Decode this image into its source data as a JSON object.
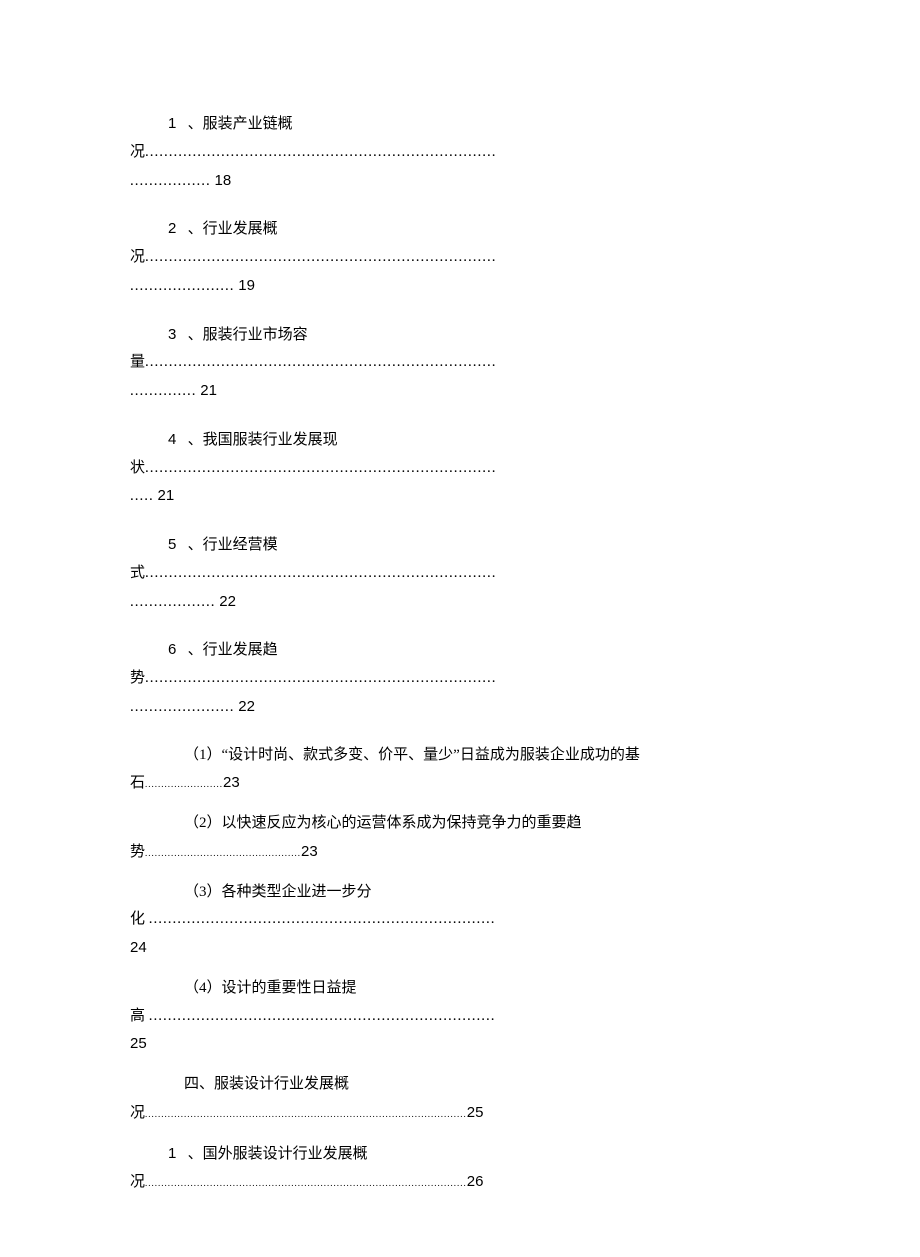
{
  "toc": [
    {
      "type": "numbered",
      "num": "1",
      "title_l1": "、服装产业链概",
      "title_l2_prefix": "况",
      "dots_l2": "..........................................................................",
      "dots_l3": ".................",
      "page": "18"
    },
    {
      "type": "numbered",
      "num": "2",
      "title_l1": "、行业发展概",
      "title_l2_prefix": "况",
      "dots_l2": "..........................................................................",
      "dots_l3": "......................",
      "page": "19"
    },
    {
      "type": "numbered",
      "num": "3",
      "title_l1": "、服装行业市场容",
      "title_l2_prefix": "量",
      "dots_l2": "..........................................................................",
      "dots_l3": "..............",
      "page": "21"
    },
    {
      "type": "numbered",
      "num": "4",
      "title_l1": "、我国服装行业发展现",
      "title_l2_prefix": "状",
      "dots_l2": "..........................................................................",
      "dots_l3": ".....",
      "page": "21"
    },
    {
      "type": "numbered",
      "num": "5",
      "title_l1": "、行业经营模",
      "title_l2_prefix": "式",
      "dots_l2": "..........................................................................",
      "dots_l3": "..................",
      "page": "22"
    },
    {
      "type": "numbered",
      "num": "6",
      "title_l1": "、行业发展趋",
      "title_l2_prefix": "势",
      "dots_l2": "..........................................................................",
      "dots_l3": "......................",
      "page": "22"
    },
    {
      "type": "sub",
      "title_l1": "（1）“设计时尚、款式多变、价平、量少”日益成为服装企业成功的基",
      "title_l2_prefix": "石",
      "dots_l2": "........................",
      "page": "23"
    },
    {
      "type": "sub",
      "title_l1": "（2）以快速反应为核心的运营体系成为保持竞争力的重要趋",
      "title_l2_prefix": "势",
      "dots_l2": "................................................",
      "page": "23"
    },
    {
      "type": "sub3",
      "title_l1": "（3）各种类型企业进一步分",
      "title_l2_prefix": "化 ",
      "dots_l2": ".........................................................................",
      "page": "24"
    },
    {
      "type": "sub3",
      "title_l1": "（4）设计的重要性日益提",
      "title_l2_prefix": "高 ",
      "dots_l2": ".........................................................................",
      "page": "25"
    },
    {
      "type": "section",
      "title_l1": "四、服装设计行业发展概",
      "title_l2_prefix": "况",
      "dots_l2": "...................................................................................................",
      "page": "25"
    },
    {
      "type": "numbered_small",
      "num": "1",
      "title_l1": "、国外服装设计行业发展概",
      "title_l2_prefix": "况",
      "dots_l2": "...................................................................................................",
      "page": "26"
    }
  ]
}
